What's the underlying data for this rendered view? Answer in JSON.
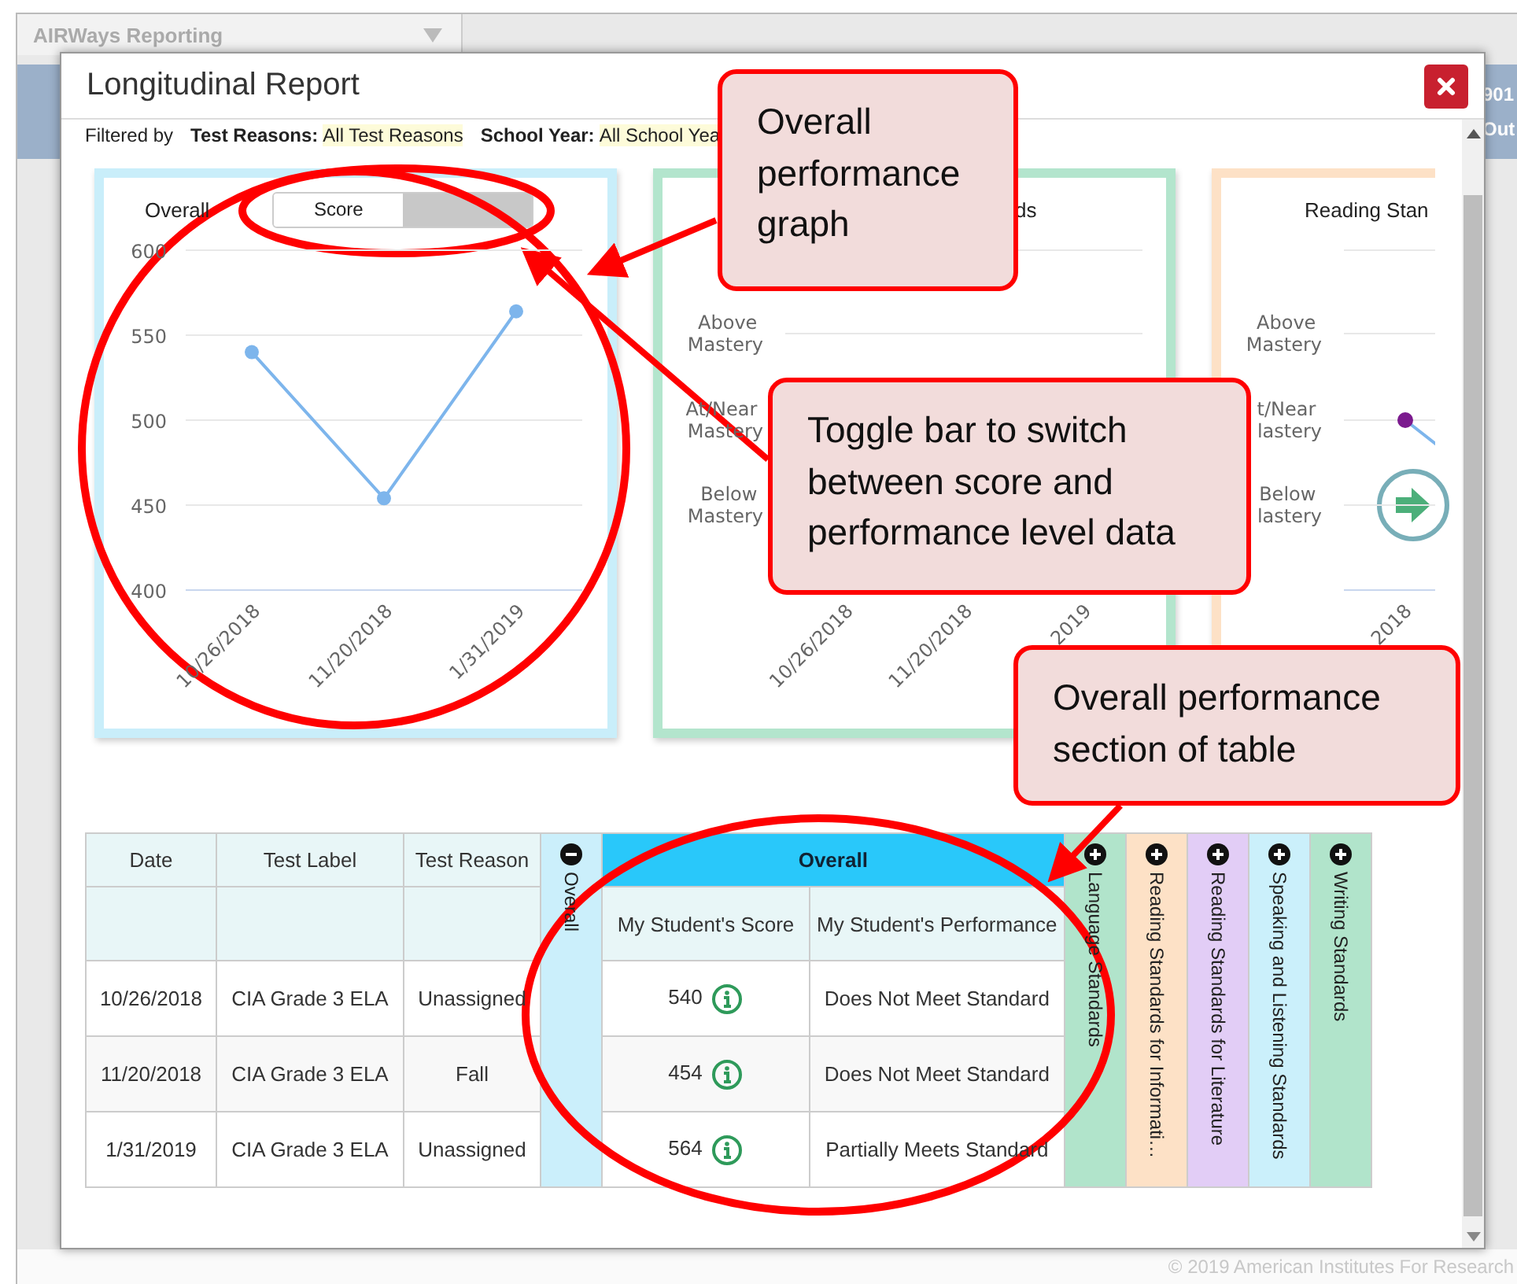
{
  "background": {
    "app_title": "AIRWays Reporting",
    "header_fragments": [
      "901",
      "Out"
    ],
    "footer": "© 2019 American Institutes For Research"
  },
  "dialog": {
    "title": "Longitudinal Report",
    "filters": {
      "prefix": "Filtered by",
      "items": [
        {
          "label": "Test Reasons:",
          "value": "All Test Reasons"
        },
        {
          "label": "School Year:",
          "value": "All School Yea"
        }
      ]
    },
    "cards": [
      {
        "kind": "score",
        "toggle": [
          {
            "label": "Score",
            "selected": true
          },
          {
            "selected": false
          }
        ],
        "chart_data": {
          "type": "line",
          "title": "Overall",
          "grid": true,
          "categories": [
            "10/26/2018",
            "11/20/2018",
            "1/31/2019"
          ],
          "series": [
            {
              "color": "#7db5ec",
              "marker": "circle",
              "values": [
                540,
                454,
                564
              ]
            }
          ],
          "ylim": [
            400,
            600
          ],
          "yticks": [
            400,
            450,
            500,
            550,
            600
          ]
        }
      },
      {
        "kind": "level",
        "title": "ds",
        "levels": [
          "Above Mastery",
          "At/Near Mastery",
          "Below Mastery"
        ],
        "dates": [
          "10/26/2018",
          "11/20/2018",
          "2019"
        ]
      },
      {
        "kind": "level",
        "title": "Reading Stan",
        "levels": [
          "Above Mastery",
          "t/Near lastery",
          "Below lastery"
        ],
        "dates": [
          "2018"
        ]
      }
    ],
    "table": {
      "columns": [
        "Date",
        "Test Label",
        "Test Reason"
      ],
      "overall": {
        "label": "Overall",
        "expanded": true,
        "group_label": "Overall",
        "subcolumns": [
          "My Student's Score",
          "My Student's Performance"
        ]
      },
      "standards": [
        {
          "label": "Language Standards",
          "color": "#b1e4cb",
          "expanded": false
        },
        {
          "label": "Reading Standards for Informati…",
          "color": "#fde1c6",
          "expanded": false
        },
        {
          "label": "Reading Standards for Literature",
          "color": "#e2cdf6",
          "expanded": false
        },
        {
          "label": "Speaking and Listening Standards",
          "color": "#cbf0fb",
          "expanded": false
        },
        {
          "label": "Writing Standards",
          "color": "#b1e4cb",
          "expanded": false
        }
      ],
      "rows": [
        {
          "date": "10/26/2018",
          "test_label": "CIA Grade 3 ELA",
          "reason": "Unassigned",
          "score": "540",
          "performance": "Does Not Meet Standard"
        },
        {
          "date": "11/20/2018",
          "test_label": "CIA Grade 3 ELA",
          "reason": "Fall",
          "score": "454",
          "performance": "Does Not Meet Standard"
        },
        {
          "date": "1/31/2019",
          "test_label": "CIA Grade 3 ELA",
          "reason": "Unassigned",
          "score": "564",
          "performance": "Partially Meets Standard"
        }
      ]
    }
  },
  "annotations": [
    {
      "text": "Overall performance graph"
    },
    {
      "text": "Toggle bar to switch between score and performance level data"
    },
    {
      "text": "Overall performance section of table"
    }
  ]
}
